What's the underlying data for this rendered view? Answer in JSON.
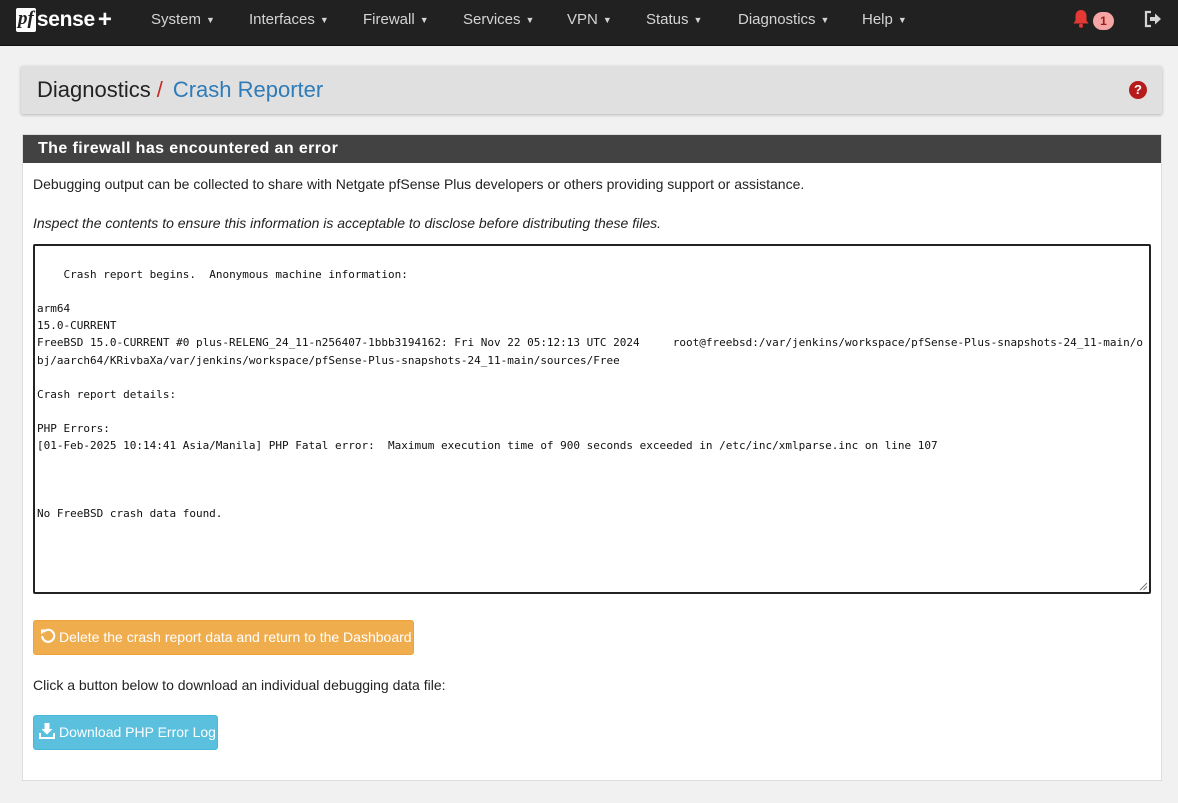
{
  "navbar": {
    "brand": {
      "pf": "pf",
      "sense": "sense",
      "plus": "+"
    },
    "items": [
      {
        "label": "System"
      },
      {
        "label": "Interfaces"
      },
      {
        "label": "Firewall"
      },
      {
        "label": "Services"
      },
      {
        "label": "VPN"
      },
      {
        "label": "Status"
      },
      {
        "label": "Diagnostics"
      },
      {
        "label": "Help"
      }
    ],
    "notification_count": "1",
    "icons": {
      "notifications": "bell-icon",
      "logout": "sign-out-icon",
      "caret": "caret-down-icon"
    },
    "colors": {
      "background": "#212121",
      "bell": "#e53935",
      "badge": "#f6a5a5"
    }
  },
  "breadcrumb": {
    "section": "Diagnostics",
    "separator": "/",
    "page": "Crash Reporter",
    "help_icon": "?"
  },
  "panel": {
    "title": "The firewall has encountered an error",
    "intro": "Debugging output can be collected to share with Netgate pfSense Plus developers or others providing support or assistance.",
    "notice": "Inspect the contents to ensure this information is acceptable to disclose before distributing these files.",
    "crash_report": "Crash report begins.  Anonymous machine information:\n\narm64\n15.0-CURRENT\nFreeBSD 15.0-CURRENT #0 plus-RELENG_24_11-n256407-1bbb3194162: Fri Nov 22 05:12:13 UTC 2024     root@freebsd:/var/jenkins/workspace/pfSense-Plus-snapshots-24_11-main/obj/aarch64/KRivbaXa/var/jenkins/workspace/pfSense-Plus-snapshots-24_11-main/sources/Free\n\nCrash report details:\n\nPHP Errors:\n[01-Feb-2025 10:14:41 Asia/Manila] PHP Fatal error:  Maximum execution time of 900 seconds exceeded in /etc/inc/xmlparse.inc on line 107\n\n\n\nNo FreeBSD crash data found.",
    "delete_button": "Delete the crash report data and return to the Dashboard",
    "download_prompt": "Click a button below to download an individual debugging data file:",
    "download_button": "Download PHP Error Log",
    "colors": {
      "warning": "#f0ad4e",
      "info": "#5bc0de",
      "heading": "#424242",
      "link": "#2e7bb8"
    }
  }
}
